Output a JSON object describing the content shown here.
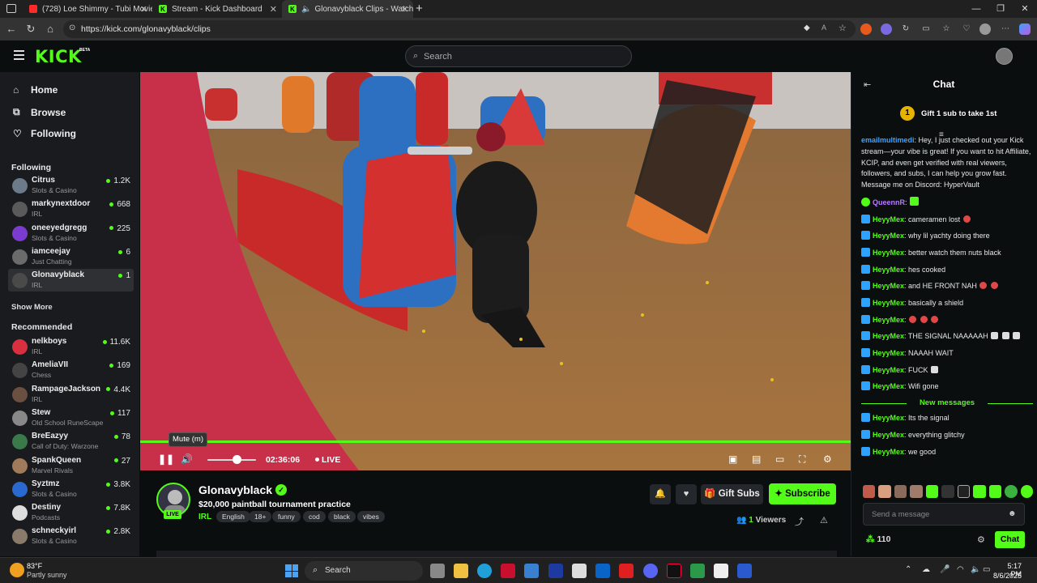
{
  "browser": {
    "tabs": [
      {
        "title": "(728) Loe Shimmy - Tubi Movie (",
        "favicon": "youtube-icon"
      },
      {
        "title": "Stream - Kick Dashboard",
        "favicon": "kick-icon"
      },
      {
        "title": "Glonavyblack Clips - Watch",
        "favicon": "kick-icon"
      }
    ],
    "url": "https://kick.com/glonavyblack/clips"
  },
  "header": {
    "logo": "KICK",
    "logo_badge": "BETA",
    "search_placeholder": "Search"
  },
  "sidebar": {
    "nav": [
      {
        "label": "Home",
        "icon": "home-icon"
      },
      {
        "label": "Browse",
        "icon": "browse-icon"
      },
      {
        "label": "Following",
        "icon": "heart-icon"
      }
    ],
    "following_title": "Following",
    "following": [
      {
        "name": "Citrus",
        "category": "Slots & Casino",
        "viewers": "1.2K",
        "color": "#6c7a8a"
      },
      {
        "name": "markynextdoor",
        "category": "IRL",
        "viewers": "668",
        "color": "#5a5a5a"
      },
      {
        "name": "oneeyedgregg",
        "category": "Slots & Casino",
        "viewers": "225",
        "color": "#7b3bd1"
      },
      {
        "name": "iamceejay",
        "category": "Just Chatting",
        "viewers": "6",
        "color": "#6b6b6b"
      },
      {
        "name": "Glonavyblack",
        "category": "IRL",
        "viewers": "1",
        "color": "#4a4a4a"
      }
    ],
    "show_more": "Show More",
    "recommended_title": "Recommended",
    "recommended": [
      {
        "name": "nelkboys",
        "category": "IRL",
        "viewers": "11.6K",
        "color": "#d93040"
      },
      {
        "name": "AmeliaVII",
        "category": "Chess",
        "viewers": "169",
        "color": "#444"
      },
      {
        "name": "RampageJackson",
        "category": "IRL",
        "viewers": "4.4K",
        "color": "#6a5040"
      },
      {
        "name": "Stew",
        "category": "Old School RuneScape",
        "viewers": "117",
        "color": "#888"
      },
      {
        "name": "BreEazyy",
        "category": "Call of Duty: Warzone",
        "viewers": "78",
        "color": "#3a7a4a"
      },
      {
        "name": "SpankQueen",
        "category": "Marvel Rivals",
        "viewers": "27",
        "color": "#a07a5a"
      },
      {
        "name": "Syztmz",
        "category": "Slots & Casino",
        "viewers": "3.8K",
        "color": "#2a6ad0"
      },
      {
        "name": "Destiny",
        "category": "Podcasts",
        "viewers": "7.8K",
        "color": "#ddd"
      },
      {
        "name": "schneckyirl",
        "category": "Slots & Casino",
        "viewers": "2.8K",
        "color": "#8a7a6a"
      }
    ]
  },
  "player": {
    "tooltip": "Mute (m)",
    "time": "02:36:06",
    "live_label": "LIVE",
    "volume_fraction": 0.6
  },
  "stream": {
    "streamer": "Glonavyblack",
    "live_badge": "LIVE",
    "title": "$20,000 paintball tournament practice",
    "category": "IRL",
    "tags": [
      "English",
      "18+",
      "funny",
      "cod",
      "black",
      "vibes"
    ],
    "gift_subs_label": "Gift Subs",
    "subscribe_label": "Subscribe",
    "viewer_count": "1",
    "viewers_label": "Viewers"
  },
  "chat": {
    "title": "Chat",
    "gift_rank": "1",
    "gift_banner": "Gift 1 sub to take 1st",
    "messages": [
      {
        "user": "emailmultimedi",
        "color": "#3fa4ff",
        "badge": "none",
        "text": "Hey, I just checked out your Kick stream—your vibe is great! If you want to hit Affiliate, KCIP, and even get verified with real viewers, followers, and subs, I can help you grow fast. Message me on Discord: HyperVault"
      },
      {
        "user": "QueennR",
        "color": "#b57bff",
        "badge": "green",
        "text": "",
        "emotes": [
          "green"
        ]
      },
      {
        "user": "HeyyMex",
        "color": "#53fc18",
        "badge": "blue",
        "text": "cameramen lost",
        "emotes": [
          "red"
        ]
      },
      {
        "user": "HeyyMex",
        "color": "#53fc18",
        "badge": "blue",
        "text": "why lil yachty doing there"
      },
      {
        "user": "HeyyMex",
        "color": "#53fc18",
        "badge": "blue",
        "text": "better watch them nuts black"
      },
      {
        "user": "HeyyMex",
        "color": "#53fc18",
        "badge": "blue",
        "text": "hes cooked"
      },
      {
        "user": "HeyyMex",
        "color": "#53fc18",
        "badge": "blue",
        "text": "and HE FRONT NAH",
        "emotes": [
          "red",
          "red"
        ]
      },
      {
        "user": "HeyyMex",
        "color": "#53fc18",
        "badge": "blue",
        "text": "basically a shield"
      },
      {
        "user": "HeyyMex",
        "color": "#53fc18",
        "badge": "blue",
        "text": "",
        "emotes": [
          "red",
          "red",
          "red"
        ]
      },
      {
        "user": "HeyyMex",
        "color": "#53fc18",
        "badge": "blue",
        "text": "THE SIGNAL NAAAAAH",
        "emotes": [
          "skull",
          "skull",
          "skull"
        ]
      },
      {
        "user": "HeyyMex",
        "color": "#53fc18",
        "badge": "blue",
        "text": "NAAAH WAIT"
      },
      {
        "user": "HeyyMex",
        "color": "#53fc18",
        "badge": "blue",
        "text": "FUCK",
        "emotes": [
          "skull"
        ]
      },
      {
        "user": "HeyyMex",
        "color": "#53fc18",
        "badge": "blue",
        "text": "Wifi gone"
      }
    ],
    "new_messages_label": "New messages",
    "new_messages": [
      {
        "user": "HeyyMex",
        "color": "#53fc18",
        "badge": "blue",
        "text": "Its the signal"
      },
      {
        "user": "HeyyMex",
        "color": "#53fc18",
        "badge": "blue",
        "text": "everything glitchy"
      },
      {
        "user": "HeyyMex",
        "color": "#53fc18",
        "badge": "blue",
        "text": "we good"
      }
    ],
    "input_placeholder": "Send a message",
    "points": "110",
    "chat_button": "Chat"
  },
  "taskbar": {
    "weather_temp": "83°F",
    "weather_cond": "Partly sunny",
    "search_label": "Search",
    "time": "5:17 PM",
    "date": "8/6/2025"
  }
}
